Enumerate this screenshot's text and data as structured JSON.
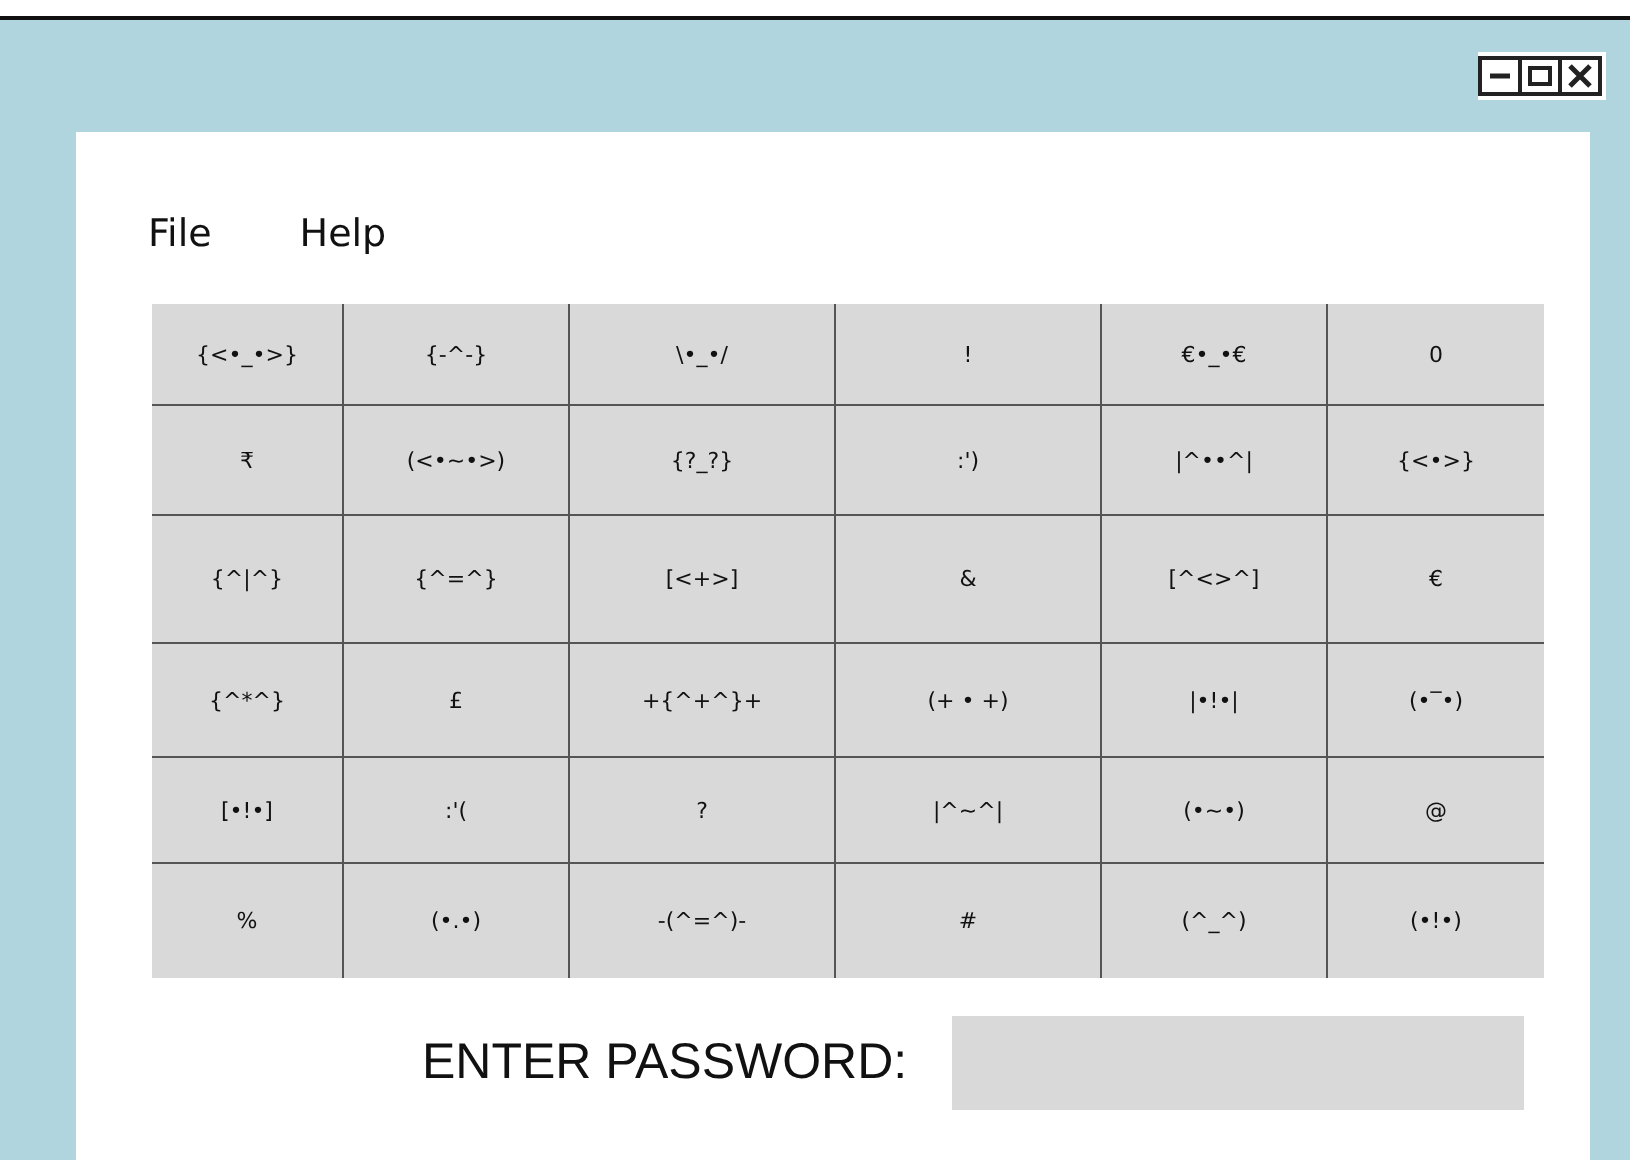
{
  "menu": [
    "File",
    "Help"
  ],
  "symbol_grid": {
    "rows": [
      [
        "{<•_•>}",
        "{-^-}",
        "\\•_•/",
        "!",
        "€•_•€",
        "0"
      ],
      [
        "₹",
        "(<•~•>)",
        "{?_?}",
        ":')",
        "|^••^|",
        "{<•>}"
      ],
      [
        "{^|^}",
        "{^=^}",
        "[<+>]",
        "&",
        "[^<>^]",
        "€"
      ],
      [
        "{^*^}",
        "£",
        "+{^+^}+",
        "(+ • +)",
        "|•!•|",
        "(•‾•)"
      ],
      [
        "[•!•]",
        ":'(",
        "?",
        "|^~^|",
        "(•~•)",
        "@"
      ],
      [
        "%",
        "(•.•)",
        "-(^=^)-",
        "#",
        "(^_^)",
        "(•!•)"
      ]
    ]
  },
  "password": {
    "label": "ENTER PASSWORD:"
  }
}
